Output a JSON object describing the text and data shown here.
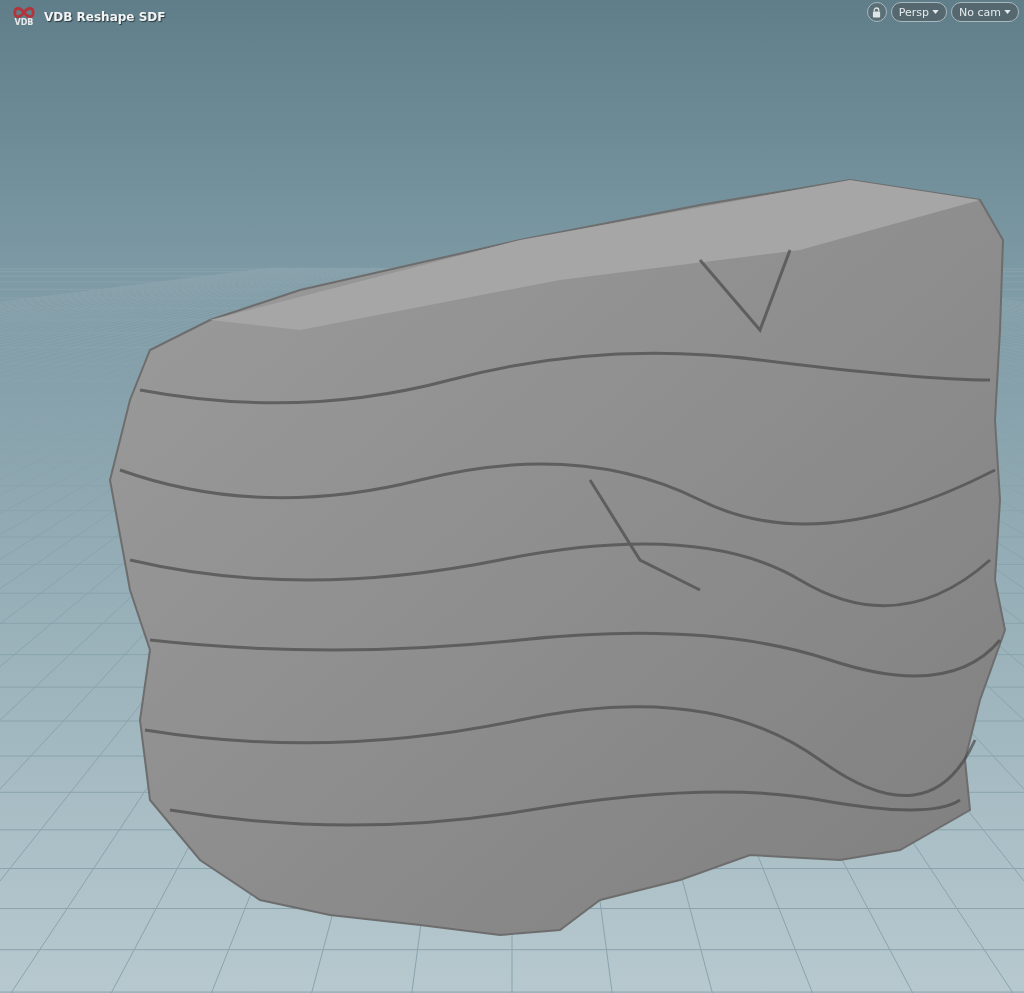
{
  "node_label": {
    "icon_text": "VDB",
    "title": "VDB Reshape SDF"
  },
  "viewport_controls": {
    "locked": true,
    "buttons": [
      {
        "label": "Persp"
      },
      {
        "label": "No cam"
      }
    ]
  }
}
